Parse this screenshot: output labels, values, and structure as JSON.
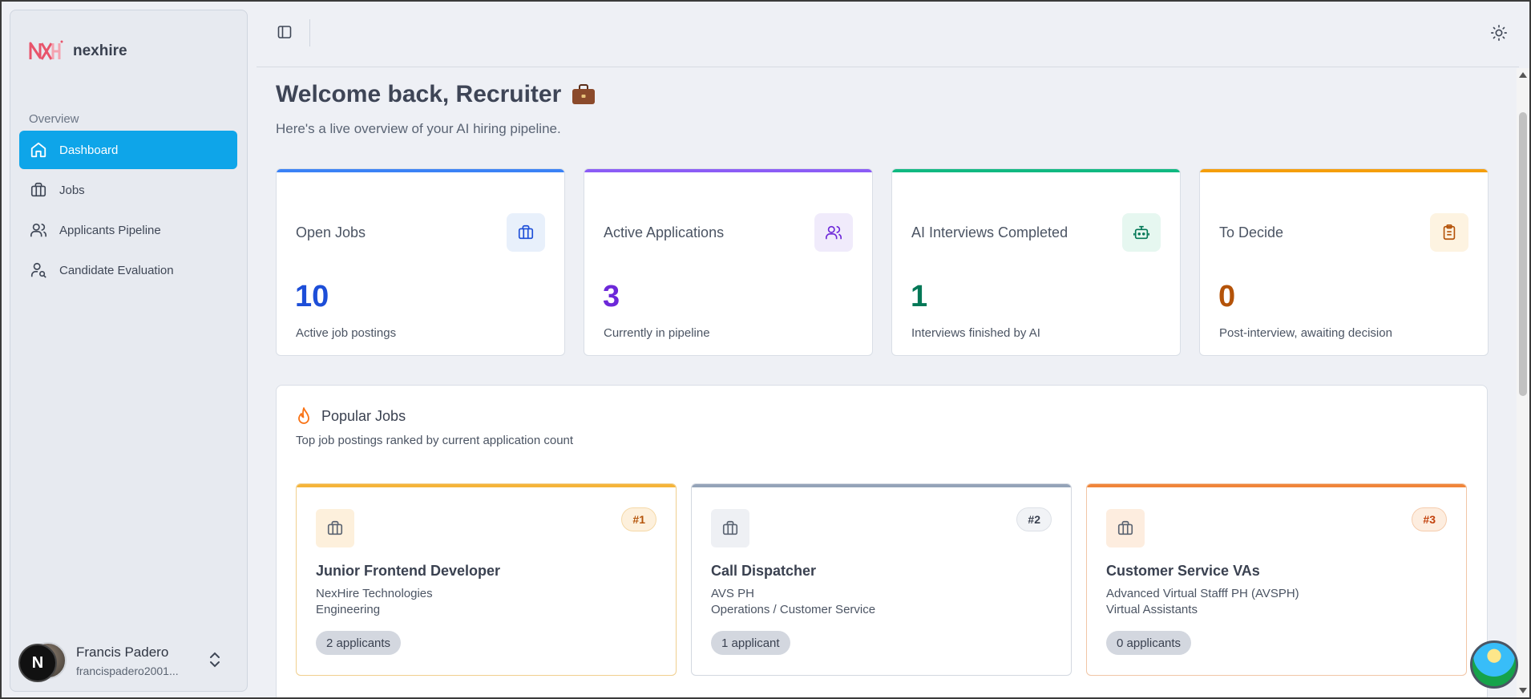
{
  "brand": {
    "name": "nexhire",
    "accent": "#e8546b"
  },
  "sidebar": {
    "section_label": "Overview",
    "items": [
      {
        "label": "Dashboard",
        "icon": "home-icon",
        "active": true
      },
      {
        "label": "Jobs",
        "icon": "briefcase-icon",
        "active": false
      },
      {
        "label": "Applicants Pipeline",
        "icon": "users-icon",
        "active": false
      },
      {
        "label": "Candidate Evaluation",
        "icon": "user-search-icon",
        "active": false
      }
    ],
    "user": {
      "name": "Francis Padero",
      "email": "francispadero2001..."
    }
  },
  "floating_badge": {
    "letter": "N"
  },
  "header": {
    "title": "Welcome back, Recruiter",
    "subtitle": "Here's a live overview of your AI hiring pipeline."
  },
  "stats": [
    {
      "title": "Open Jobs",
      "value": "10",
      "desc": "Active job postings",
      "color": "#1d4ed8",
      "bar": "#3b82f6",
      "icon": "briefcase-icon"
    },
    {
      "title": "Active Applications",
      "value": "3",
      "desc": "Currently in pipeline",
      "color": "#6d28d9",
      "bar": "#8b5cf6",
      "icon": "users-icon"
    },
    {
      "title": "AI Interviews Completed",
      "value": "1",
      "desc": "Interviews finished by AI",
      "color": "#047857",
      "bar": "#10b981",
      "icon": "bot-icon"
    },
    {
      "title": "To Decide",
      "value": "0",
      "desc": "Post-interview, awaiting decision",
      "color": "#b45309",
      "bar": "#f59e0b",
      "icon": "clipboard-icon"
    }
  ],
  "popular_jobs": {
    "title": "Popular Jobs",
    "subtitle": "Top job postings ranked by current application count",
    "jobs": [
      {
        "rank": "#1",
        "title": "Junior Frontend Developer",
        "company": "NexHire Technologies",
        "department": "Engineering",
        "applicants": "2 applicants"
      },
      {
        "rank": "#2",
        "title": "Call Dispatcher",
        "company": "AVS PH",
        "department": "Operations / Customer Service",
        "applicants": "1 applicant"
      },
      {
        "rank": "#3",
        "title": "Customer Service VAs",
        "company": "Advanced Virtual Stafff PH (AVSPH)",
        "department": "Virtual Assistants",
        "applicants": "0 applicants"
      }
    ]
  }
}
